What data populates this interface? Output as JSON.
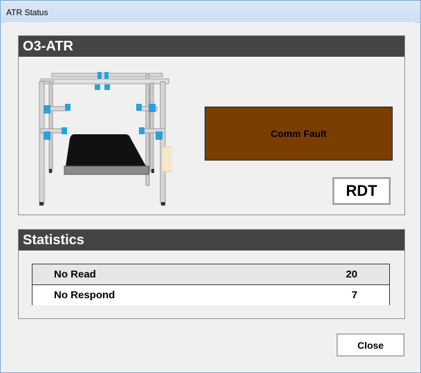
{
  "window": {
    "title": "ATR Status"
  },
  "atr_panel": {
    "header": "O3-ATR",
    "status_text": "Comm Fault",
    "status_color": "#7b3e02",
    "rdt_label": "RDT"
  },
  "statistics": {
    "header": "Statistics",
    "rows": [
      {
        "label": "No Read",
        "value": "20"
      },
      {
        "label": "No Respond",
        "value": "7"
      }
    ]
  },
  "buttons": {
    "close_label": "Close"
  }
}
